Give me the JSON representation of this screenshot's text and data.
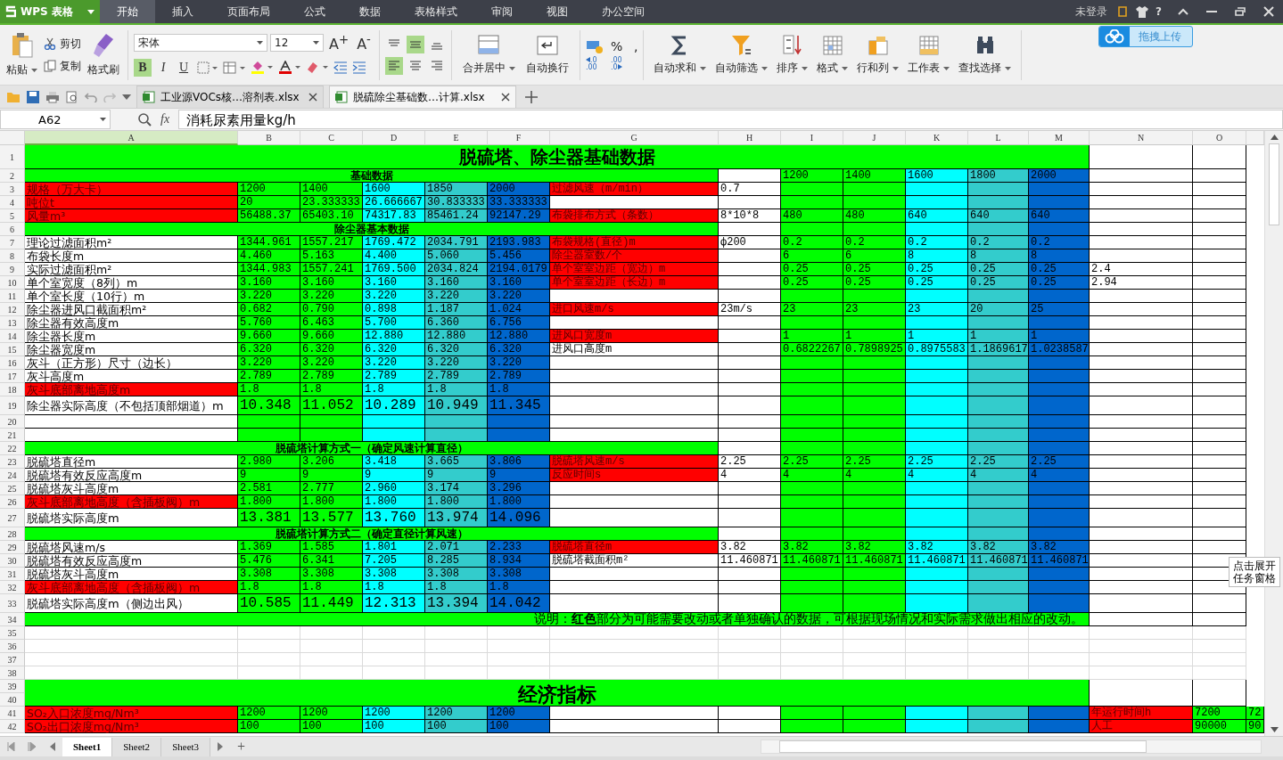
{
  "menu_bar": {
    "app": "WPS 表格",
    "tabs": [
      {
        "label": "开始",
        "selected": true
      },
      {
        "label": "插入",
        "selected": false
      },
      {
        "label": "页面布局",
        "selected": false
      },
      {
        "label": "公式",
        "selected": false
      },
      {
        "label": "数据",
        "selected": false
      },
      {
        "label": "表格样式",
        "selected": false
      },
      {
        "label": "审阅",
        "selected": false
      },
      {
        "label": "视图",
        "selected": false
      },
      {
        "label": "办公空间",
        "selected": false
      }
    ],
    "account": "未登录",
    "help": "?"
  },
  "ribbon": {
    "paste": "粘贴",
    "cut": "剪切",
    "copy": "复制",
    "painter": "格式刷",
    "font_name": "宋体",
    "font_size": "12",
    "grow": "A$^{+}$",
    "shrink": "A$^{-}$",
    "styles": [
      {
        "kind": "bold",
        "label": "B",
        "on": true
      },
      {
        "kind": "italic",
        "label": "I",
        "on": false
      },
      {
        "kind": "underline",
        "label": "U",
        "on": false
      }
    ],
    "align": [
      {
        "kind": "top",
        "selected": false
      },
      {
        "kind": "middle",
        "selected": true
      },
      {
        "kind": "bottom",
        "selected": false
      },
      {
        "kind": "left",
        "selected": true
      },
      {
        "kind": "center",
        "selected": false
      },
      {
        "kind": "right",
        "selected": false
      }
    ],
    "merge": "合并居中",
    "wrap": "自动换行",
    "percent": "%",
    "comma": ",",
    "decimals": [
      {
        "kind": "more",
        "label": ".0 .00"
      },
      {
        "kind": "less",
        "label": ".00 .0"
      }
    ],
    "commands": [
      {
        "kind": "sum",
        "label": "自动求和"
      },
      {
        "kind": "filter",
        "label": "自动筛选"
      },
      {
        "kind": "sort",
        "label": "排序"
      },
      {
        "kind": "format",
        "label": "格式"
      },
      {
        "kind": "rows",
        "label": "行和列"
      },
      {
        "kind": "sheet",
        "label": "工作表"
      },
      {
        "kind": "find",
        "label": "查找选择"
      }
    ],
    "upload": "拖拽上传"
  },
  "doc_tabs": [
    {
      "label": "工业源VOCs核…溶剂表.xlsx",
      "selected": false
    },
    {
      "label": "脱硫除尘基础数…计算.xlsx",
      "selected": true
    }
  ],
  "formula_bar": {
    "cell": "A62",
    "fx": "fx",
    "value": "消耗尿素用量kg/h"
  },
  "sheet": {
    "columns": [
      {
        "label": "A",
        "selected": true
      },
      {
        "label": "B",
        "selected": false,
        "color": "#00ff00"
      },
      {
        "label": "C",
        "selected": false,
        "color": "#00ff00"
      },
      {
        "label": "D",
        "selected": false,
        "color": "#00ffff"
      },
      {
        "label": "E",
        "selected": false,
        "color": "#33cccc"
      },
      {
        "label": "F",
        "selected": false,
        "color": "#0066cc"
      },
      {
        "label": "G",
        "selected": false
      },
      {
        "label": "H",
        "selected": false
      },
      {
        "label": "I",
        "selected": false,
        "color": "#00ff00"
      },
      {
        "label": "J",
        "selected": false,
        "color": "#00ff00"
      },
      {
        "label": "K",
        "selected": false,
        "color": "#00ffff"
      },
      {
        "label": "L",
        "selected": false,
        "color": "#33cccc"
      },
      {
        "label": "M",
        "selected": false,
        "color": "#0066cc"
      },
      {
        "label": "N",
        "selected": false
      },
      {
        "label": "O",
        "selected": false
      },
      {
        "selected": false
      }
    ],
    "rows": [
      {
        "numbers": [
          "1"
        ],
        "kind": "title",
        "text": "脱硫塔、除尘器基础数据",
        "cells": [
          null,
          null,
          null,
          null,
          null,
          null,
          null,
          null,
          null,
          null,
          null,
          null,
          null,
          null,
          null,
          null
        ]
      },
      {
        "numbers": [
          "2"
        ],
        "kind": "band",
        "text": "基础数据",
        "cells": [
          null,
          null,
          null,
          null,
          null,
          null,
          null,
          null,
          {
            "text": "1200"
          },
          {
            "text": "1400"
          },
          {
            "text": "1600"
          },
          {
            "text": "1800"
          },
          {
            "text": "2000"
          },
          null,
          null,
          null
        ]
      },
      {
        "numbers": [
          "3"
        ],
        "kind": "data",
        "cells": [
          {
            "text": "规格（万大卡）",
            "color": "#ff0000"
          },
          {
            "text": "1200"
          },
          {
            "text": "1400"
          },
          {
            "text": "1600"
          },
          {
            "text": "1850"
          },
          {
            "text": "2000"
          },
          {
            "text": "过滤风速（m/min）",
            "color": "#ff0000"
          },
          {
            "text": "0.7"
          },
          null,
          null,
          null,
          null,
          null,
          null,
          null,
          null
        ]
      },
      {
        "numbers": [
          "4"
        ],
        "kind": "data",
        "cells": [
          {
            "text": "吨位t",
            "color": "#ff0000"
          },
          {
            "text": "20"
          },
          {
            "text": "23.333333"
          },
          {
            "text": "26.666667"
          },
          {
            "text": "30.833333"
          },
          {
            "text": "33.333333"
          },
          null,
          null,
          null,
          null,
          null,
          null,
          null,
          null,
          null,
          null
        ]
      },
      {
        "numbers": [
          "5"
        ],
        "kind": "data",
        "cells": [
          {
            "text": "风量m³",
            "color": "#ff0000"
          },
          {
            "text": "56488.37"
          },
          {
            "text": "65403.10"
          },
          {
            "text": "74317.83"
          },
          {
            "text": "85461.24"
          },
          {
            "text": "92147.29"
          },
          {
            "text": "布袋排布方式（条数）",
            "color": "#ff0000"
          },
          {
            "text": "8*10*8"
          },
          {
            "text": "480"
          },
          {
            "text": "480"
          },
          {
            "text": "640"
          },
          {
            "text": "640"
          },
          {
            "text": "640"
          },
          null,
          null,
          null
        ]
      },
      {
        "numbers": [
          "6"
        ],
        "kind": "band",
        "text": "除尘器基本数据",
        "cells": [
          null,
          null,
          null,
          null,
          null,
          null,
          null,
          null,
          null,
          null,
          null,
          null,
          null,
          null,
          null,
          null
        ]
      },
      {
        "numbers": [
          "7"
        ],
        "kind": "data",
        "cells": [
          {
            "text": "理论过滤面积m²"
          },
          {
            "text": "1344.961"
          },
          {
            "text": "1557.217"
          },
          {
            "text": "1769.472"
          },
          {
            "text": "2034.791"
          },
          {
            "text": "2193.983"
          },
          {
            "text": "布袋规格(直径)m",
            "color": "#ff0000"
          },
          {
            "text": "ф200"
          },
          {
            "text": "0.2"
          },
          {
            "text": "0.2"
          },
          {
            "text": "0.2"
          },
          {
            "text": "0.2"
          },
          {
            "text": "0.2"
          },
          null,
          null,
          null
        ]
      },
      {
        "numbers": [
          "8"
        ],
        "kind": "data",
        "cells": [
          {
            "text": "布袋长度m"
          },
          {
            "text": "4.460"
          },
          {
            "text": "5.163"
          },
          {
            "text": "4.400"
          },
          {
            "text": "5.060"
          },
          {
            "text": "5.456"
          },
          {
            "text": "除尘器室数/个",
            "color": "#ff0000"
          },
          null,
          {
            "text": "6"
          },
          {
            "text": "6"
          },
          {
            "text": "8"
          },
          {
            "text": "8"
          },
          {
            "text": "8"
          },
          null,
          null,
          null
        ]
      },
      {
        "numbers": [
          "9"
        ],
        "kind": "data",
        "cells": [
          {
            "text": "实际过滤面积m²"
          },
          {
            "text": "1344.983"
          },
          {
            "text": "1557.241"
          },
          {
            "text": "1769.500"
          },
          {
            "text": "2034.824"
          },
          {
            "text": "2194.0179"
          },
          {
            "text": "单个室室边距（宽边）m",
            "color": "#ff0000"
          },
          null,
          {
            "text": "0.25"
          },
          {
            "text": "0.25"
          },
          {
            "text": "0.25"
          },
          {
            "text": "0.25"
          },
          {
            "text": "0.25"
          },
          {
            "text": "2.4"
          },
          null,
          null
        ]
      },
      {
        "numbers": [
          "10"
        ],
        "kind": "data",
        "cells": [
          {
            "text": "单个室宽度（8列）m"
          },
          {
            "text": "3.160"
          },
          {
            "text": "3.160"
          },
          {
            "text": "3.160"
          },
          {
            "text": "3.160"
          },
          {
            "text": "3.160"
          },
          {
            "text": "单个室室边距（长边）m",
            "color": "#ff0000"
          },
          null,
          {
            "text": "0.25"
          },
          {
            "text": "0.25"
          },
          {
            "text": "0.25"
          },
          {
            "text": "0.25"
          },
          {
            "text": "0.25"
          },
          {
            "text": "2.94"
          },
          null,
          null
        ]
      },
      {
        "numbers": [
          "11"
        ],
        "kind": "data",
        "cells": [
          {
            "text": "单个室长度（10行）m"
          },
          {
            "text": "3.220"
          },
          {
            "text": "3.220"
          },
          {
            "text": "3.220"
          },
          {
            "text": "3.220"
          },
          {
            "text": "3.220"
          },
          null,
          null,
          null,
          null,
          null,
          null,
          null,
          null,
          null,
          null
        ]
      },
      {
        "numbers": [
          "12"
        ],
        "kind": "data",
        "cells": [
          {
            "text": "除尘器进风口截面积m²"
          },
          {
            "text": "0.682"
          },
          {
            "text": "0.790"
          },
          {
            "text": "0.898"
          },
          {
            "text": "1.187"
          },
          {
            "text": "1.024"
          },
          {
            "text": "进口风速m/s",
            "color": "#ff0000"
          },
          {
            "text": "23m/s"
          },
          {
            "text": "23"
          },
          {
            "text": "23"
          },
          {
            "text": "23"
          },
          {
            "text": "20"
          },
          {
            "text": "25"
          },
          null,
          null,
          null
        ]
      },
      {
        "numbers": [
          "13"
        ],
        "kind": "data",
        "cells": [
          {
            "text": "除尘器有效高度m"
          },
          {
            "text": "5.760"
          },
          {
            "text": "6.463"
          },
          {
            "text": "5.700"
          },
          {
            "text": "6.360"
          },
          {
            "text": "6.756"
          },
          null,
          null,
          null,
          null,
          null,
          null,
          null,
          null,
          null,
          null
        ]
      },
      {
        "numbers": [
          "14"
        ],
        "kind": "data",
        "cells": [
          {
            "text": "除尘器长度m"
          },
          {
            "text": "9.660"
          },
          {
            "text": "9.660"
          },
          {
            "text": "12.880"
          },
          {
            "text": "12.880"
          },
          {
            "text": "12.880"
          },
          {
            "text": "进风口宽度m",
            "color": "#ff0000"
          },
          null,
          {
            "text": "1"
          },
          {
            "text": "1"
          },
          {
            "text": "1"
          },
          {
            "text": "1"
          },
          {
            "text": "1"
          },
          null,
          null,
          null
        ]
      },
      {
        "numbers": [
          "15"
        ],
        "kind": "data",
        "cells": [
          {
            "text": "除尘器宽度m"
          },
          {
            "text": "6.320"
          },
          {
            "text": "6.320"
          },
          {
            "text": "6.320"
          },
          {
            "text": "6.320"
          },
          {
            "text": "6.320"
          },
          {
            "text": "进风口高度m"
          },
          null,
          {
            "text": "0.6822267"
          },
          {
            "text": "0.7898925"
          },
          {
            "text": "0.8975583"
          },
          {
            "text": "1.1869617"
          },
          {
            "text": "1.0238587"
          },
          null,
          null,
          null
        ]
      },
      {
        "numbers": [
          "16"
        ],
        "kind": "data",
        "cells": [
          {
            "text": "灰斗（正方形）尺寸（边长）"
          },
          {
            "text": "3.220"
          },
          {
            "text": "3.220"
          },
          {
            "text": "3.220"
          },
          {
            "text": "3.220"
          },
          {
            "text": "3.220"
          },
          null,
          null,
          null,
          null,
          null,
          null,
          null,
          null,
          null,
          null
        ]
      },
      {
        "numbers": [
          "17"
        ],
        "kind": "data",
        "cells": [
          {
            "text": "灰斗高度m"
          },
          {
            "text": "2.789"
          },
          {
            "text": "2.789"
          },
          {
            "text": "2.789"
          },
          {
            "text": "2.789"
          },
          {
            "text": "2.789"
          },
          null,
          null,
          null,
          null,
          null,
          null,
          null,
          null,
          null,
          null
        ]
      },
      {
        "numbers": [
          "18"
        ],
        "kind": "data",
        "cells": [
          {
            "text": "灰斗底部离地高度m",
            "color": "#ff0000"
          },
          {
            "text": "1.8"
          },
          {
            "text": "1.8"
          },
          {
            "text": "1.8"
          },
          {
            "text": "1.8"
          },
          {
            "text": "1.8"
          },
          null,
          null,
          null,
          null,
          null,
          null,
          null,
          null,
          null,
          null
        ]
      },
      {
        "numbers": [
          "19"
        ],
        "kind": "large",
        "cells": [
          {
            "text": "除尘器实际高度（不包括顶部烟道）m"
          },
          {
            "text": "10.348"
          },
          {
            "text": "11.052"
          },
          {
            "text": "10.289"
          },
          {
            "text": "10.949"
          },
          {
            "text": "11.345"
          },
          null,
          null,
          null,
          null,
          null,
          null,
          null,
          null,
          null,
          null
        ]
      },
      {
        "numbers": [
          "20"
        ],
        "kind": "data",
        "cells": [
          null,
          null,
          null,
          null,
          null,
          null,
          null,
          null,
          null,
          null,
          null,
          null,
          null,
          null,
          null,
          null
        ]
      },
      {
        "numbers": [
          "21"
        ],
        "kind": "data",
        "cells": [
          null,
          null,
          null,
          null,
          null,
          null,
          null,
          null,
          null,
          null,
          null,
          null,
          null,
          null,
          null,
          null
        ]
      },
      {
        "numbers": [
          "22"
        ],
        "kind": "band",
        "text": "脱硫塔计算方式一（确定风速计算直径）",
        "cells": [
          null,
          null,
          null,
          null,
          null,
          null,
          null,
          null,
          null,
          null,
          null,
          null,
          null,
          null,
          null,
          null
        ]
      },
      {
        "numbers": [
          "23"
        ],
        "kind": "data",
        "cells": [
          {
            "text": "脱硫塔直径m"
          },
          {
            "text": "2.980"
          },
          {
            "text": "3.206"
          },
          {
            "text": "3.418"
          },
          {
            "text": "3.665"
          },
          {
            "text": "3.806"
          },
          {
            "text": "脱硫塔风速m/s",
            "color": "#ff0000"
          },
          {
            "text": "2.25"
          },
          {
            "text": "2.25"
          },
          {
            "text": "2.25"
          },
          {
            "text": "2.25"
          },
          {
            "text": "2.25"
          },
          {
            "text": "2.25"
          },
          null,
          null,
          null
        ]
      },
      {
        "numbers": [
          "24"
        ],
        "kind": "data",
        "cells": [
          {
            "text": "脱硫塔有效反应高度m"
          },
          {
            "text": "9"
          },
          {
            "text": "9"
          },
          {
            "text": "9"
          },
          {
            "text": "9"
          },
          {
            "text": "9"
          },
          {
            "text": "反应时间s",
            "color": "#ff0000"
          },
          {
            "text": "4"
          },
          {
            "text": "4"
          },
          {
            "text": "4"
          },
          {
            "text": "4"
          },
          {
            "text": "4"
          },
          {
            "text": "4"
          },
          null,
          null,
          null
        ]
      },
      {
        "numbers": [
          "25"
        ],
        "kind": "data",
        "cells": [
          {
            "text": "脱硫塔灰斗高度m"
          },
          {
            "text": "2.581"
          },
          {
            "text": "2.777"
          },
          {
            "text": "2.960"
          },
          {
            "text": "3.174"
          },
          {
            "text": "3.296"
          },
          null,
          null,
          null,
          null,
          null,
          null,
          null,
          null,
          null,
          null
        ]
      },
      {
        "numbers": [
          "26"
        ],
        "kind": "data",
        "cells": [
          {
            "text": "灰斗底部离地高度（含插板阀）m",
            "color": "#ff0000"
          },
          {
            "text": "1.800"
          },
          {
            "text": "1.800"
          },
          {
            "text": "1.800"
          },
          {
            "text": "1.800"
          },
          {
            "text": "1.800"
          },
          null,
          null,
          null,
          null,
          null,
          null,
          null,
          null,
          null,
          null
        ]
      },
      {
        "numbers": [
          "27"
        ],
        "kind": "large",
        "cells": [
          {
            "text": "脱硫塔实际高度m"
          },
          {
            "text": "13.381"
          },
          {
            "text": "13.577"
          },
          {
            "text": "13.760"
          },
          {
            "text": "13.974"
          },
          {
            "text": "14.096"
          },
          null,
          null,
          null,
          null,
          null,
          null,
          null,
          null,
          null,
          null
        ]
      },
      {
        "numbers": [
          "28"
        ],
        "kind": "band",
        "text": "脱硫塔计算方式二（确定直径计算风速）",
        "cells": [
          null,
          null,
          null,
          null,
          null,
          null,
          null,
          null,
          null,
          null,
          null,
          null,
          null,
          null,
          null,
          null
        ]
      },
      {
        "numbers": [
          "29"
        ],
        "kind": "data",
        "cells": [
          {
            "text": "脱硫塔风速m/s"
          },
          {
            "text": "1.369"
          },
          {
            "text": "1.585"
          },
          {
            "text": "1.801"
          },
          {
            "text": "2.071"
          },
          {
            "text": "2.233"
          },
          {
            "text": "脱硫塔直径m",
            "color": "#ff0000"
          },
          {
            "text": "3.82"
          },
          {
            "text": "3.82"
          },
          {
            "text": "3.82"
          },
          {
            "text": "3.82"
          },
          {
            "text": "3.82"
          },
          {
            "text": "3.82"
          },
          null,
          null,
          null
        ]
      },
      {
        "numbers": [
          "30"
        ],
        "kind": "data",
        "cells": [
          {
            "text": "脱硫塔有效反应高度m"
          },
          {
            "text": "5.476"
          },
          {
            "text": "6.341"
          },
          {
            "text": "7.205"
          },
          {
            "text": "8.285"
          },
          {
            "text": "8.934"
          },
          {
            "text": "脱硫塔截面积m²"
          },
          {
            "text": "11.460871"
          },
          {
            "text": "11.460871"
          },
          {
            "text": "11.460871"
          },
          {
            "text": "11.460871"
          },
          {
            "text": "11.460871"
          },
          {
            "text": "11.460871"
          },
          null,
          null,
          null
        ]
      },
      {
        "numbers": [
          "31"
        ],
        "kind": "data",
        "cells": [
          {
            "text": "脱硫塔灰斗高度m"
          },
          {
            "text": "3.308"
          },
          {
            "text": "3.308"
          },
          {
            "text": "3.308"
          },
          {
            "text": "3.308"
          },
          {
            "text": "3.308"
          },
          null,
          null,
          null,
          null,
          null,
          null,
          null,
          null,
          null,
          null
        ]
      },
      {
        "numbers": [
          "32"
        ],
        "kind": "data",
        "cells": [
          {
            "text": "灰斗底部离地高度（含插板阀）m",
            "color": "#ff0000"
          },
          {
            "text": "1.8"
          },
          {
            "text": "1.8"
          },
          {
            "text": "1.8"
          },
          {
            "text": "1.8"
          },
          {
            "text": "1.8"
          },
          null,
          null,
          null,
          null,
          null,
          null,
          null,
          null,
          null,
          null
        ]
      },
      {
        "numbers": [
          "33"
        ],
        "kind": "large",
        "cells": [
          {
            "text": "脱硫塔实际高度m（侧边出风）"
          },
          {
            "text": "10.585"
          },
          {
            "text": "11.449"
          },
          {
            "text": "12.313"
          },
          {
            "text": "13.394"
          },
          {
            "text": "14.042"
          },
          null,
          null,
          null,
          null,
          null,
          null,
          null,
          null,
          null,
          null
        ]
      },
      {
        "numbers": [
          "34"
        ],
        "kind": "note",
        "text": "说明：**红色**部分为可能需要改动或者单独确认的数据，可根据现场情况和实际需求做出相应的改动。",
        "cells": [
          null,
          null,
          null,
          null,
          null,
          null,
          null,
          null,
          null,
          null,
          null,
          null,
          null,
          null,
          null,
          null
        ]
      },
      {
        "numbers": [
          "35"
        ],
        "kind": "blank",
        "cells": [
          null,
          null,
          null,
          null,
          null,
          null,
          null,
          null,
          null,
          null,
          null,
          null,
          null,
          null,
          null,
          null
        ]
      },
      {
        "numbers": [
          "36"
        ],
        "kind": "blank",
        "cells": [
          null,
          null,
          null,
          null,
          null,
          null,
          null,
          null,
          null,
          null,
          null,
          null,
          null,
          null,
          null,
          null
        ]
      },
      {
        "numbers": [
          "37"
        ],
        "kind": "blank",
        "cells": [
          null,
          null,
          null,
          null,
          null,
          null,
          null,
          null,
          null,
          null,
          null,
          null,
          null,
          null,
          null,
          null
        ]
      },
      {
        "numbers": [
          "38"
        ],
        "kind": "blank",
        "cells": [
          null,
          null,
          null,
          null,
          null,
          null,
          null,
          null,
          null,
          null,
          null,
          null,
          null,
          null,
          null,
          null
        ]
      },
      {
        "numbers": [
          "39",
          "40"
        ],
        "kind": "heading",
        "text": "经济指标",
        "cells": [
          null,
          null,
          null,
          null,
          null,
          null,
          null,
          null,
          null,
          null,
          null,
          null,
          null,
          null,
          null,
          null
        ]
      },
      {
        "numbers": [
          "41"
        ],
        "kind": "data",
        "cells": [
          {
            "text": "SO₂入口浓度mg/Nm³",
            "color": "#ff0000"
          },
          {
            "text": "1200"
          },
          {
            "text": "1200"
          },
          {
            "text": "1200"
          },
          {
            "text": "1200"
          },
          {
            "text": "1200"
          },
          null,
          null,
          null,
          null,
          null,
          null,
          null,
          {
            "text": "年运行时间h",
            "color": "#ff0000"
          },
          {
            "text": "7200",
            "color": "#00ff00"
          },
          {
            "text": "72",
            "color": "#00ff00"
          }
        ]
      },
      {
        "numbers": [
          "42"
        ],
        "kind": "data",
        "cells": [
          {
            "text": "SO₂出口浓度mg/Nm³",
            "color": "#ff0000"
          },
          {
            "text": "100"
          },
          {
            "text": "100"
          },
          {
            "text": "100"
          },
          {
            "text": "100"
          },
          {
            "text": "100"
          },
          null,
          null,
          null,
          null,
          null,
          null,
          null,
          {
            "text": "人工",
            "color": "#ff0000"
          },
          {
            "text": "90000",
            "color": "#00ff00"
          },
          {
            "text": "90",
            "color": "#00ff00"
          }
        ]
      }
    ]
  },
  "sheet_tabs": [
    {
      "label": "Sheet1",
      "selected": true
    },
    {
      "label": "Sheet2",
      "selected": false
    },
    {
      "label": "Sheet3",
      "selected": false
    }
  ],
  "add_sheet": "+",
  "task_pane_tip": "点击展开任务窗格"
}
